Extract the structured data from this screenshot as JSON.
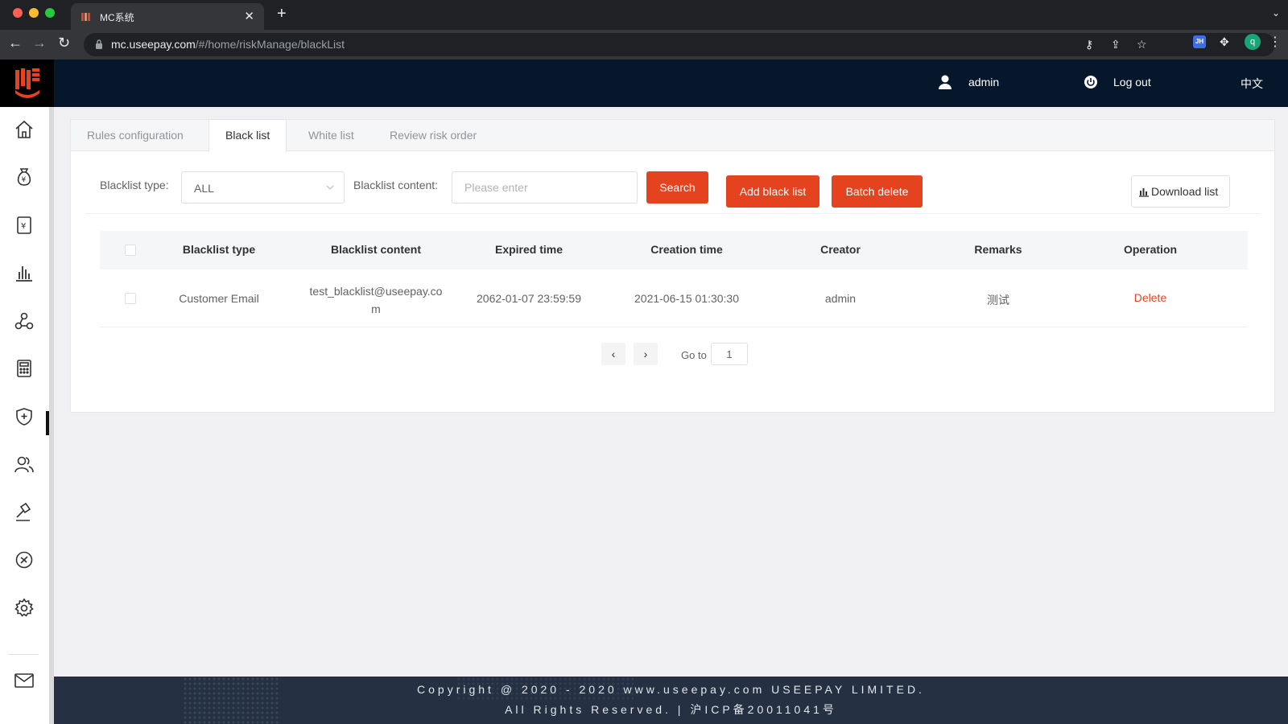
{
  "browser": {
    "tab_title": "MC系统",
    "url_host": "mc.useepay.com",
    "url_path": "/#/home/riskManage/blackList",
    "profile_initial": "q",
    "extension_label": "JH"
  },
  "header": {
    "user": "admin",
    "logout": "Log out",
    "language": "中文"
  },
  "sidebar": {
    "icons": [
      "home-icon",
      "money-bag-icon",
      "currency-icon",
      "bar-chart-icon",
      "network-icon",
      "calculator-icon",
      "shield-icon",
      "users-icon",
      "gavel-icon",
      "no-fly-icon",
      "gear-icon",
      "mail-icon"
    ],
    "active": "shield-icon"
  },
  "tabs": [
    "Rules configuration",
    "Black list",
    "White list",
    "Review risk order"
  ],
  "active_tab": "Black list",
  "filters": {
    "type_label": "Blacklist type:",
    "type_value": "ALL",
    "content_label": "Blacklist content:",
    "content_placeholder": "Please enter",
    "search": "Search",
    "add": "Add black list",
    "batch_delete": "Batch delete",
    "download": "Download list"
  },
  "table": {
    "columns": [
      "Blacklist type",
      "Blacklist content",
      "Expired time",
      "Creation time",
      "Creator",
      "Remarks",
      "Operation"
    ],
    "rows": [
      {
        "type": "Customer Email",
        "content_line1": "test_blacklist@useepay.co",
        "content_line2": "m",
        "expired": "2062-01-07 23:59:59",
        "created": "2021-06-15 01:30:30",
        "creator": "admin",
        "remarks": "测试",
        "operation": "Delete"
      }
    ]
  },
  "pagination": {
    "prev": "‹",
    "next": "›",
    "goto_label": "Go to",
    "page": "1"
  },
  "footer": {
    "line1": "Copyright @ 2020 - 2020 www.useepay.com USEEPAY LIMITED.",
    "line2": "All Rights Reserved. | 沪ICP备20011041号"
  },
  "colors": {
    "accent": "#e5421f",
    "header_bg": "#06172c",
    "footer_bg": "#253042"
  }
}
